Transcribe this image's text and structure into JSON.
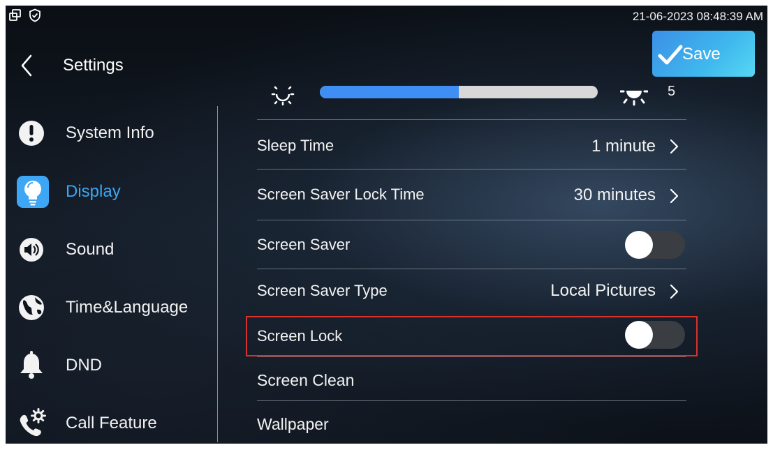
{
  "status_bar": {
    "icons": [
      "multi-window-icon",
      "shield-check-icon"
    ],
    "datetime": "21-06-2023 08:48:39 AM"
  },
  "header": {
    "back_icon": "chevron-left-icon",
    "title": "Settings",
    "save_label": "Save",
    "save_icon": "checkmark-icon"
  },
  "sidebar": {
    "items": [
      {
        "label": "System Info",
        "icon": "info-exclamation-icon",
        "active": false
      },
      {
        "label": "Display",
        "icon": "lightbulb-icon",
        "active": true
      },
      {
        "label": "Sound",
        "icon": "speaker-icon",
        "active": false
      },
      {
        "label": "Time&Language",
        "icon": "globe-icon",
        "active": false
      },
      {
        "label": "DND",
        "icon": "bell-icon",
        "active": false
      },
      {
        "label": "Call Feature",
        "icon": "phone-gear-icon",
        "active": false
      }
    ]
  },
  "brightness": {
    "low_icon": "brightness-low-icon",
    "high_icon": "brightness-high-icon",
    "level_fraction": 0.5,
    "value": "5"
  },
  "settings": {
    "sleep_time": {
      "label": "Sleep Time",
      "value": "1 minute"
    },
    "screen_saver_lock_time": {
      "label": "Screen Saver Lock Time",
      "value": "30 minutes"
    },
    "screen_saver": {
      "label": "Screen Saver",
      "enabled": false
    },
    "screen_saver_type": {
      "label": "Screen Saver Type",
      "value": "Local Pictures"
    },
    "screen_lock": {
      "label": "Screen Lock",
      "enabled": false
    },
    "screen_clean": {
      "label": "Screen Clean"
    },
    "wallpaper": {
      "label": "Wallpaper"
    }
  },
  "colors": {
    "accent": "#3da6f5",
    "save_button": "#3fb8ee",
    "highlight": "#d9312b",
    "slider_fill": "#3e8ef3",
    "toggle_off": "#3a3d42"
  }
}
